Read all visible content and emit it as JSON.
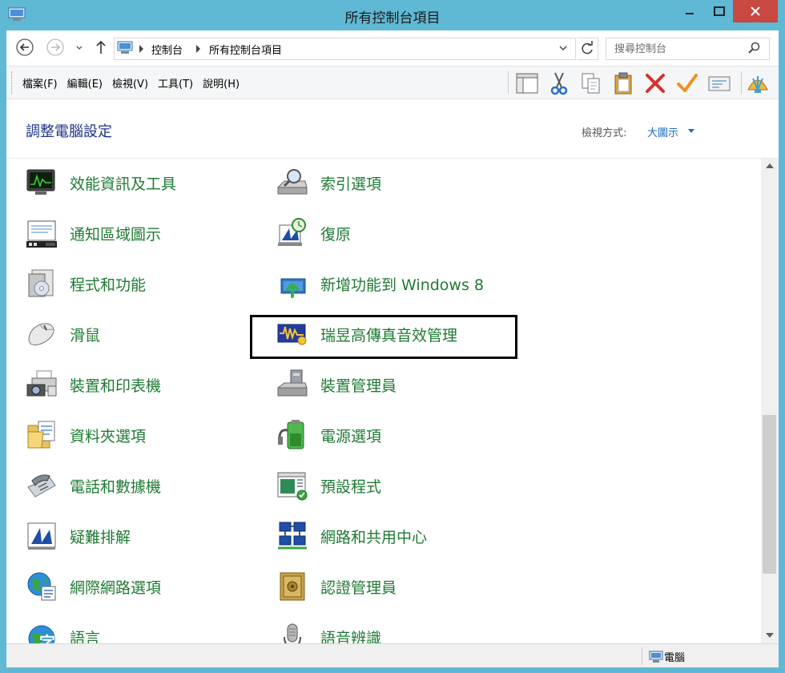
{
  "window": {
    "title": "所有控制台項目",
    "buttons": {
      "minimize": "minimize-icon",
      "maximize": "maximize-icon",
      "close": "close-icon"
    }
  },
  "address": {
    "breadcrumb": [
      "控制台",
      "所有控制台項目"
    ],
    "search_placeholder": "搜尋控制台"
  },
  "menu": [
    "檔案(F)",
    "編輯(E)",
    "檢視(V)",
    "工具(T)",
    "說明(H)"
  ],
  "toolbar_icons": [
    "layout-pane-icon",
    "cut-icon",
    "copy-icon",
    "paste-icon",
    "delete-icon",
    "checkmark-icon",
    "properties-icon",
    "shell-icon"
  ],
  "header": {
    "title": "調整電腦設定",
    "view_by_label": "檢視方式:",
    "view_mode": "大圖示"
  },
  "items": {
    "left": [
      {
        "label": "效能資訊及工具",
        "icon": "performance-monitor-icon"
      },
      {
        "label": "通知區域圖示",
        "icon": "notification-area-icon"
      },
      {
        "label": "程式和功能",
        "icon": "programs-features-icon"
      },
      {
        "label": "滑鼠",
        "icon": "mouse-icon"
      },
      {
        "label": "裝置和印表機",
        "icon": "devices-printers-icon"
      },
      {
        "label": "資料夾選項",
        "icon": "folder-options-icon"
      },
      {
        "label": "電話和數據機",
        "icon": "phone-modem-icon"
      },
      {
        "label": "疑難排解",
        "icon": "troubleshooting-icon"
      },
      {
        "label": "網際網路選項",
        "icon": "internet-options-icon"
      },
      {
        "label": "語言",
        "icon": "language-icon"
      }
    ],
    "right": [
      {
        "label": "索引選項",
        "icon": "indexing-options-icon"
      },
      {
        "label": "復原",
        "icon": "recovery-icon"
      },
      {
        "label": "新增功能到 Windows 8",
        "icon": "add-features-icon"
      },
      {
        "label": "瑞昱高傳真音效管理",
        "icon": "realtek-audio-icon"
      },
      {
        "label": "裝置管理員",
        "icon": "device-manager-icon"
      },
      {
        "label": "電源選項",
        "icon": "power-options-icon"
      },
      {
        "label": "預設程式",
        "icon": "default-programs-icon"
      },
      {
        "label": "網路和共用中心",
        "icon": "network-sharing-icon"
      },
      {
        "label": "認證管理員",
        "icon": "credential-manager-icon"
      },
      {
        "label": "語音辨識",
        "icon": "speech-recognition-icon"
      }
    ]
  },
  "status": {
    "location": "電腦"
  }
}
